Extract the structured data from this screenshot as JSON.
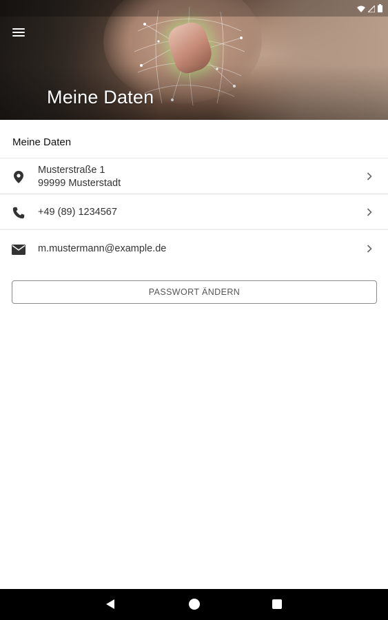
{
  "header": {
    "title": "Meine Daten",
    "menu_icon": "menu-icon"
  },
  "statusbar": {
    "icons": [
      "wifi-icon",
      "signal-icon",
      "battery-icon"
    ]
  },
  "section": {
    "title": "Meine Daten"
  },
  "address": {
    "line1": "Musterstraße 1",
    "line2": "99999 Musterstadt",
    "icon": "location-pin-icon"
  },
  "phone": {
    "value": "+49 (89) 1234567",
    "icon": "phone-icon"
  },
  "email": {
    "value": "m.mustermann@example.de",
    "icon": "mail-icon"
  },
  "actions": {
    "change_password_label": "PASSWORT ÄNDERN"
  },
  "navbar": {
    "icons": [
      "back-icon",
      "home-icon",
      "recents-icon"
    ]
  },
  "colors": {
    "text_primary": "#222222",
    "divider": "#ececec",
    "navbar_bg": "#000000",
    "button_border": "#8a8a8a"
  }
}
